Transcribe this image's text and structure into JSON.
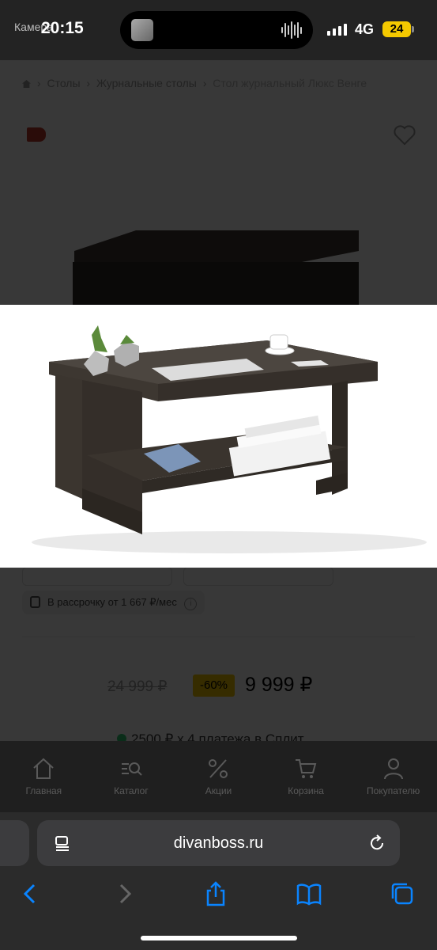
{
  "status_bar": {
    "back_app": "Камера",
    "time": "20:15",
    "network": "4G",
    "battery": "24"
  },
  "breadcrumbs": {
    "items": [
      "Столы",
      "Журнальные столы"
    ],
    "current": "Стол журнальный Люкс Венге"
  },
  "installment": {
    "label": "В рассрочку от 1 667 ₽/мес",
    "info": "i"
  },
  "price": {
    "old": "24 999 ₽",
    "discount": "-60%",
    "current": "9 999 ₽"
  },
  "split": {
    "text": "2500 ₽ х 4 платежа в Сплит"
  },
  "bottom_nav": {
    "items": [
      {
        "label": "Главная",
        "icon": "home-icon"
      },
      {
        "label": "Каталог",
        "icon": "catalog-search-icon"
      },
      {
        "label": "Акции",
        "icon": "percent-icon"
      },
      {
        "label": "Корзина",
        "icon": "cart-icon"
      },
      {
        "label": "Покупателю",
        "icon": "user-icon"
      }
    ]
  },
  "browser": {
    "url": "divanboss.ru"
  },
  "colors": {
    "accent_yellow": "#f4c900",
    "safari_blue": "#0a84ff",
    "table_wenge": "#3f3934"
  }
}
